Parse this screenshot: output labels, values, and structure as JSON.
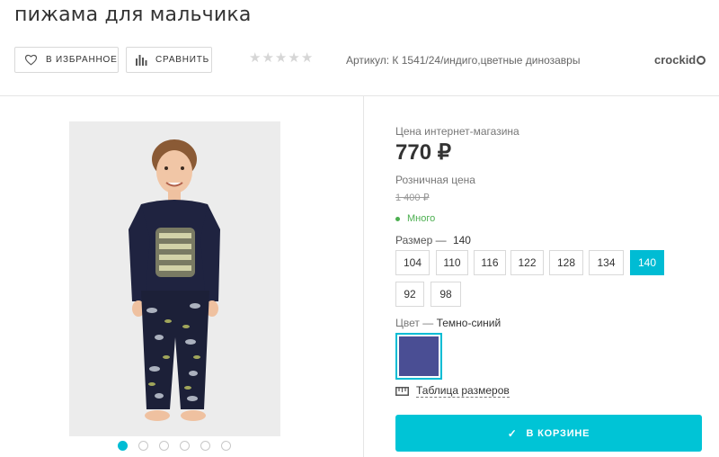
{
  "product": {
    "title": "пижама для мальчика",
    "article": "Артикул: К 1541/24/индиго,цветные динозавры",
    "brand": "crockid",
    "rating_stars": 5
  },
  "actions": {
    "favorite_label": "В ИЗБРАННОЕ",
    "compare_label": "СРАВНИТЬ"
  },
  "gallery": {
    "image_count": 6,
    "active_index": 0
  },
  "pricing": {
    "online_label": "Цена интернет-магазина",
    "online_price": "770 ₽",
    "retail_label": "Розничная цена",
    "retail_price": "1 400 ₽",
    "stock": "Много"
  },
  "size": {
    "label": "Размер",
    "dash": "—",
    "selected": "140",
    "options": [
      "104",
      "110",
      "116",
      "122",
      "128",
      "134",
      "140",
      "92",
      "98"
    ]
  },
  "color": {
    "label": "Цвет",
    "dash": "—",
    "selected": "Темно-синий",
    "swatch_hex": "#4a4e94"
  },
  "size_table_label": "Таблица размеров",
  "cart_label": "В КОРЗИНЕ",
  "colors": {
    "accent": "#00c4d6",
    "in_stock": "#4caf50"
  }
}
